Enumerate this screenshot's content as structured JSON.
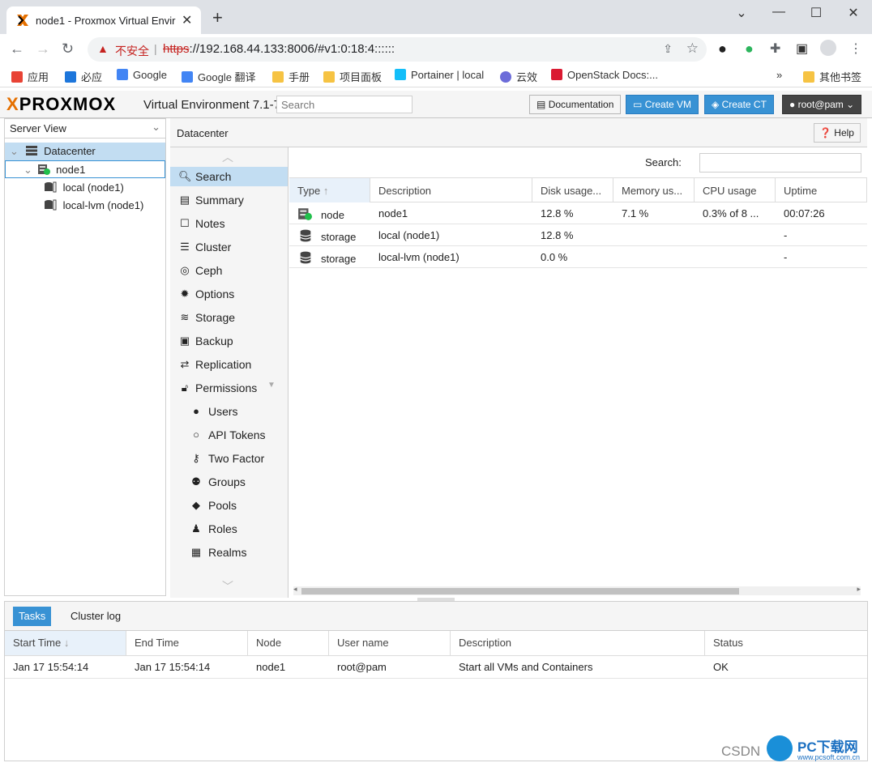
{
  "browser": {
    "tab_title": "node1 - Proxmox Virtual Envir",
    "new_tab": "+",
    "insecure_label": "不安全",
    "url_proto": "https",
    "url_rest": "://192.168.44.133:8006/#v1:0:18:4::::::",
    "bookmarks": [
      "应用",
      "必应",
      "Google",
      "Google 翻译",
      "手册",
      "项目面板",
      "Portainer | local",
      "云效",
      "OpenStack Docs:...",
      "»",
      "其他书签"
    ]
  },
  "header": {
    "logo_x": "X",
    "logo_text": "PROXMOX",
    "version": "Virtual Environment 7.1-7",
    "search_placeholder": "Search",
    "doc_label": "Documentation",
    "create_vm_label": "Create VM",
    "create_ct_label": "Create CT",
    "user_label": "root@pam"
  },
  "left": {
    "view": "Server View",
    "tree": [
      "Datacenter",
      "node1",
      "local (node1)",
      "local-lvm (node1)"
    ]
  },
  "center": {
    "title": "Datacenter",
    "help_label": "Help",
    "nav": [
      "Search",
      "Summary",
      "Notes",
      "Cluster",
      "Ceph",
      "Options",
      "Storage",
      "Backup",
      "Replication",
      "Permissions",
      "Users",
      "API Tokens",
      "Two Factor",
      "Groups",
      "Pools",
      "Roles",
      "Realms"
    ]
  },
  "grid": {
    "search_label": "Search:",
    "columns": [
      "Type",
      "Description",
      "Disk usage...",
      "Memory us...",
      "CPU usage",
      "Uptime"
    ],
    "rows": [
      [
        "node",
        "node1",
        "12.8 %",
        "7.1 %",
        "0.3% of 8 ...",
        "00:07:26"
      ],
      [
        "storage",
        "local (node1)",
        "12.8 %",
        "",
        "",
        "-"
      ],
      [
        "storage",
        "local-lvm (node1)",
        "0.0 %",
        "",
        "",
        "-"
      ]
    ]
  },
  "tasks": {
    "tabs": [
      "Tasks",
      "Cluster log"
    ],
    "columns": [
      "Start Time",
      "End Time",
      "Node",
      "User name",
      "Description",
      "Status"
    ],
    "rows": [
      [
        "Jan 17 15:54:14",
        "Jan 17 15:54:14",
        "node1",
        "root@pam",
        "Start all VMs and Containers",
        "OK"
      ]
    ]
  },
  "watermark": {
    "csdn": "CSDN",
    "brand": "PC下载网",
    "site": "www.pcsoft.com.cn"
  },
  "colors": {
    "accent": "#3892d4",
    "selected": "#c2ddf2",
    "proxmox_orange": "#e57000"
  }
}
